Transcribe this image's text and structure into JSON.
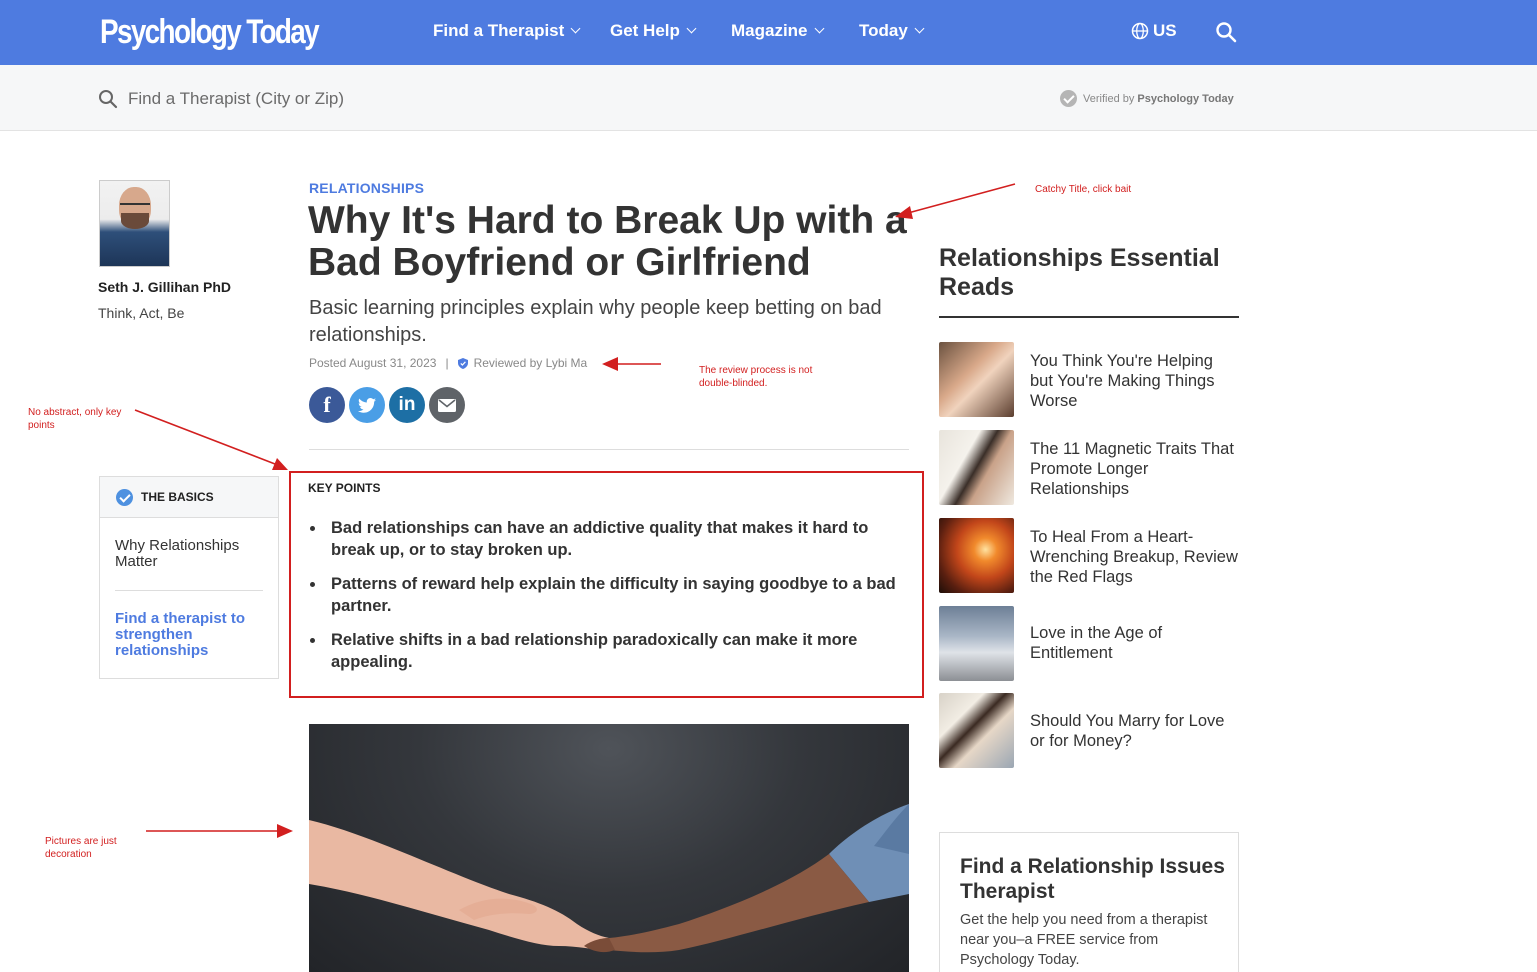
{
  "header": {
    "logo": "Psychology Today",
    "nav": [
      "Find a Therapist",
      "Get Help",
      "Magazine",
      "Today"
    ],
    "region": "US"
  },
  "searchbar": {
    "placeholder": "Find a Therapist (City or Zip)",
    "verified_prefix": "Verified by",
    "verified_brand": "Psychology Today"
  },
  "author": {
    "name": "Seth J. Gillihan PhD",
    "blog": "Think, Act, Be"
  },
  "basics": {
    "heading": "THE BASICS",
    "items": [
      "Why Relationships Matter",
      "Find a therapist to strengthen relationships"
    ]
  },
  "article": {
    "category": "RELATIONSHIPS",
    "title": "Why It's Hard to Break Up with a Bad Boyfriend or Girlfriend",
    "subtitle": "Basic learning principles explain why people keep betting on bad relationships.",
    "posted": "Posted August 31, 2023",
    "separator": "|",
    "reviewed": "Reviewed by Lybi Ma",
    "key_points_heading": "KEY POINTS",
    "key_points": [
      "Bad relationships can have an addictive quality that makes it hard to break up, or to stay broken up.",
      "Patterns of reward help explain the difficulty in saying goodbye to a bad partner.",
      "Relative shifts in a bad relationship paradoxically can make it more appealing."
    ]
  },
  "sidebar": {
    "essential_title": "Relationships Essential Reads",
    "essential_items": [
      "You Think You're Helping but You're Making Things Worse",
      "The 11 Magnetic Traits That Promote Longer Relationships",
      "To Heal From a Heart-Wrenching Breakup, Review the Red Flags",
      "Love in the Age of Entitlement",
      "Should You Marry for Love or for Money?"
    ],
    "cta_title": "Find a Relationship Issues Therapist",
    "cta_text": "Get the help you need from a therapist near you–a FREE service from Psychology Today."
  },
  "annotations": {
    "catchy_title": "Catchy Title, click bait",
    "review": "The review process is not double-blinded.",
    "abstract": "No abstract, only key points",
    "pictures": "Pictures are just decoration"
  },
  "colors": {
    "brand_blue": "#4e7be0",
    "annotation_red": "#d21f1f"
  },
  "icons": {
    "globe": "globe-icon",
    "search": "search-icon",
    "verified": "check-circle-icon",
    "facebook": "facebook-icon",
    "twitter": "twitter-icon",
    "linkedin": "linkedin-icon",
    "email": "email-icon"
  }
}
